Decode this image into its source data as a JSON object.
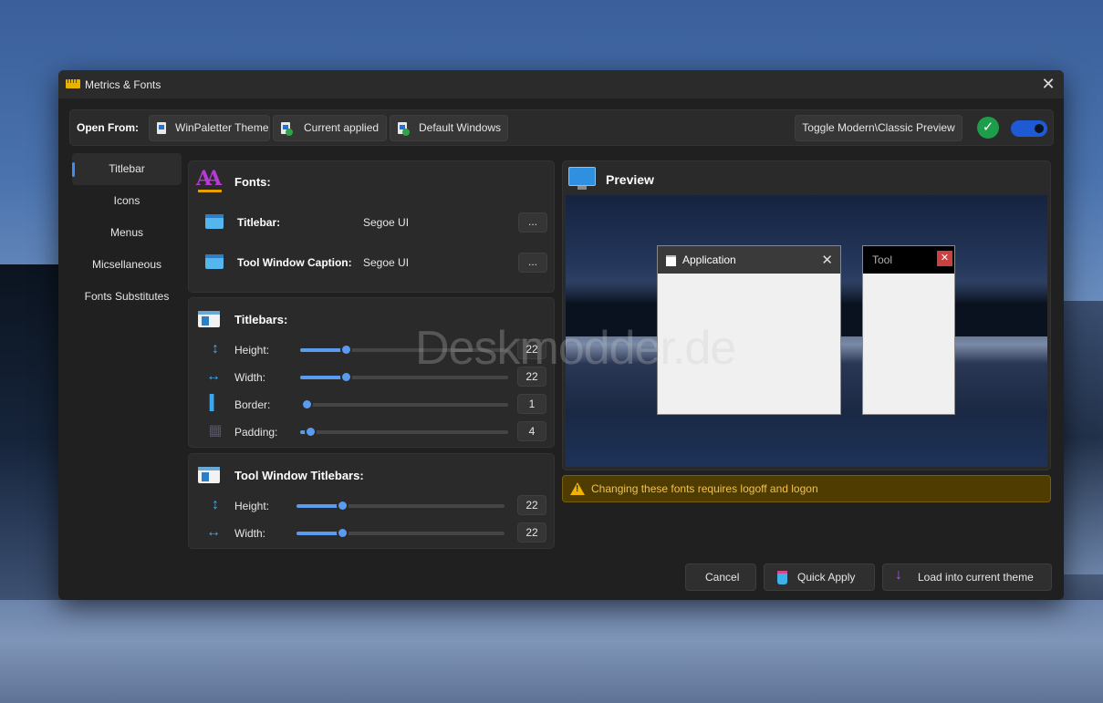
{
  "window": {
    "title": "Metrics & Fonts"
  },
  "open_from": {
    "label": "Open From:",
    "buttons": [
      "WinPaletter Theme",
      "Current applied",
      "Default Windows"
    ],
    "toggle_preview": "Toggle Modern\\Classic Preview"
  },
  "nav": {
    "items": [
      "Titlebar",
      "Icons",
      "Menus",
      "Micsellaneous",
      "Fonts Substitutes"
    ],
    "active": 0
  },
  "fonts": {
    "title": "Fonts:",
    "rows": [
      {
        "label": "Titlebar:",
        "value": "Segoe UI",
        "button": "..."
      },
      {
        "label": "Tool Window Caption:",
        "value": "Segoe UI",
        "button": "..."
      }
    ]
  },
  "titlebars": {
    "title": "Titlebars:",
    "rows": [
      {
        "label": "Height:",
        "value": "22",
        "level": 0.22
      },
      {
        "label": "Width:",
        "value": "22",
        "level": 0.22
      },
      {
        "label": "Border:",
        "value": "1",
        "level": 0.0
      },
      {
        "label": "Padding:",
        "value": "4",
        "level": 0.05
      }
    ]
  },
  "tool_titlebars": {
    "title": "Tool Window Titlebars:",
    "rows": [
      {
        "label": "Height:",
        "value": "22",
        "level": 0.22
      },
      {
        "label": "Width:",
        "value": "22",
        "level": 0.22
      }
    ]
  },
  "preview": {
    "title": "Preview",
    "app_window_title": "Application",
    "tool_window_title": "Tool"
  },
  "warning": "Changing these fonts requires logoff and logon",
  "footer": {
    "cancel": "Cancel",
    "quick_apply": "Quick Apply",
    "load": "Load into current theme"
  },
  "watermark": "Deskmodder.de",
  "colors": {
    "accent": "#5a9bf0",
    "warning": "#f2c14e",
    "toggle_on": "#1e5ad4"
  }
}
